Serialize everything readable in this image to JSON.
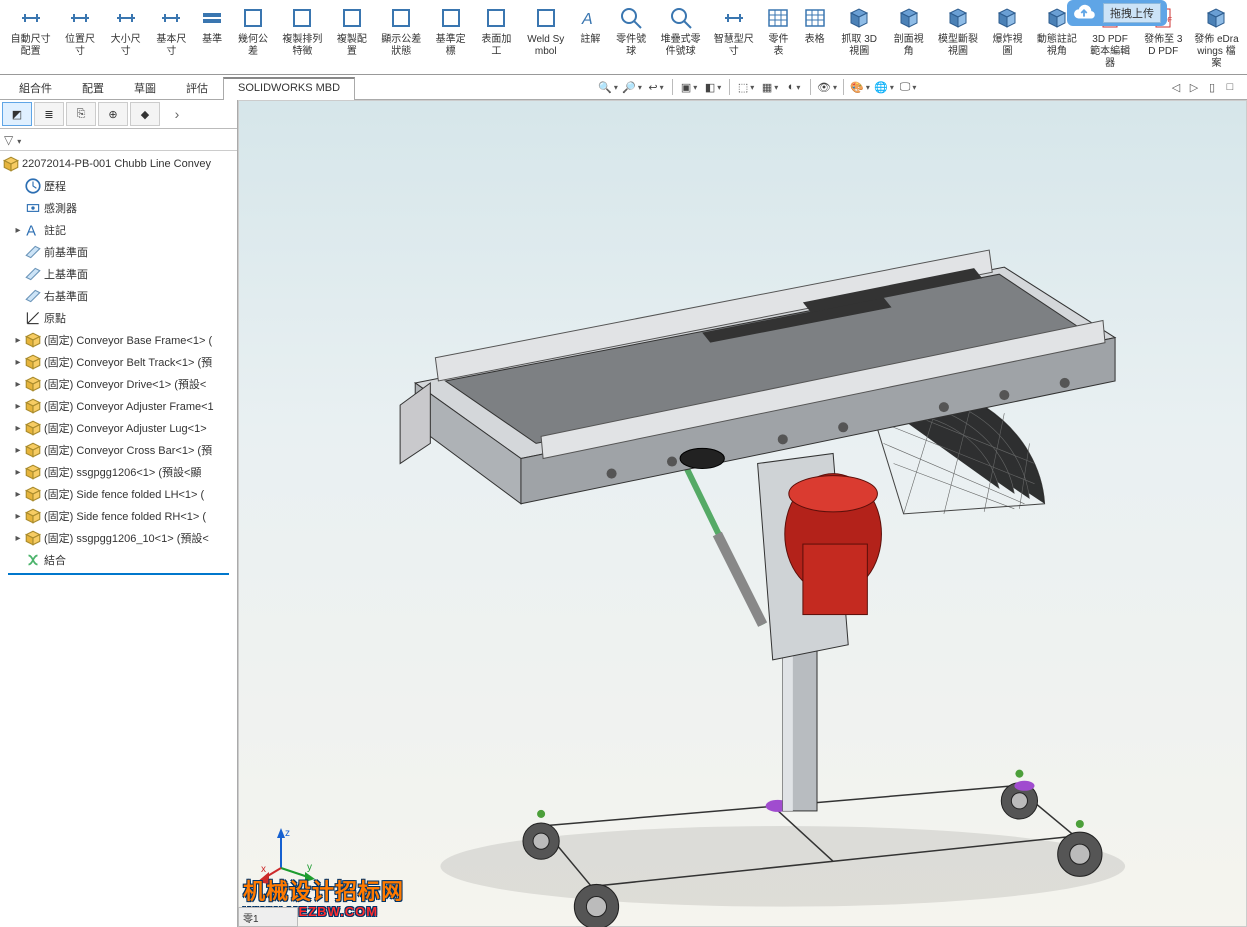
{
  "upload": {
    "label": "拖拽上传"
  },
  "ribbon": [
    {
      "name": "auto-dimension",
      "label": "自動尺寸配置"
    },
    {
      "name": "location-dimension",
      "label": "位置尺寸"
    },
    {
      "name": "size-dimension",
      "label": "大小尺寸"
    },
    {
      "name": "basic-dimension",
      "label": "基本尺寸"
    },
    {
      "name": "datum",
      "label": "基準"
    },
    {
      "name": "geometric-tolerance",
      "label": "幾何公差"
    },
    {
      "name": "pattern-feature",
      "label": "複製排列特徵"
    },
    {
      "name": "copy-scheme",
      "label": "複製配置"
    },
    {
      "name": "show-tolerance-status",
      "label": "顯示公差狀態"
    },
    {
      "name": "datum-target",
      "label": "基準定標"
    },
    {
      "name": "surface-finish",
      "label": "表面加工"
    },
    {
      "name": "weld-symbol",
      "label": "Weld Symbol"
    },
    {
      "name": "note",
      "label": "註解"
    },
    {
      "name": "balloon",
      "label": "零件號球"
    },
    {
      "name": "stacked-balloon",
      "label": "堆疊式零件號球"
    },
    {
      "name": "smart-dimension",
      "label": "智慧型尺寸"
    },
    {
      "name": "tables",
      "label": "零件表"
    },
    {
      "name": "tables2",
      "label": "表格"
    },
    {
      "name": "capture-3d-view",
      "label": "抓取 3D 視圖"
    },
    {
      "name": "section-view",
      "label": "剖面視角"
    },
    {
      "name": "model-break-view",
      "label": "模型斷裂視圖"
    },
    {
      "name": "exploded-view",
      "label": "爆炸視圖"
    },
    {
      "name": "dynamic-annotation",
      "label": "動態註記視角"
    },
    {
      "name": "3dpdf-template",
      "label": "3D PDF 範本編輯器"
    },
    {
      "name": "publish-3dpdf",
      "label": "發佈至 3D PDF"
    },
    {
      "name": "publish-edrawings",
      "label": "發佈 eDrawings 檔案"
    }
  ],
  "tabs": {
    "items": [
      "組合件",
      "配置",
      "草圖",
      "評估",
      "SOLIDWORKS MBD"
    ],
    "activeIndex": 4
  },
  "view_toolbar_icons": [
    "zoom-fit",
    "zoom-area",
    "prev-view",
    "section",
    "display-style",
    "cube",
    "scene",
    "shadow",
    "visibility",
    "appearance",
    "render",
    "monitor"
  ],
  "pane_right_icons": [
    "prev",
    "next",
    "split",
    "max"
  ],
  "sidebar": {
    "tabs": [
      "feature-tree",
      "property",
      "config",
      "display",
      "appearance"
    ],
    "root": "22072014-PB-001 Chubb Line Convey",
    "items": [
      {
        "icon": "history",
        "label": "歷程"
      },
      {
        "icon": "sensor",
        "label": "感測器"
      },
      {
        "icon": "annotation",
        "label": "註記",
        "expandable": true
      },
      {
        "icon": "plane",
        "label": "前基準面"
      },
      {
        "icon": "plane",
        "label": "上基準面"
      },
      {
        "icon": "plane",
        "label": "右基準面"
      },
      {
        "icon": "origin",
        "label": "原點"
      },
      {
        "icon": "part",
        "label": "(固定) Conveyor Base Frame<1> (",
        "expandable": true
      },
      {
        "icon": "part",
        "label": "(固定) Conveyor Belt Track<1> (預",
        "expandable": true
      },
      {
        "icon": "part",
        "label": "(固定) Conveyor Drive<1> (預設<",
        "expandable": true
      },
      {
        "icon": "part",
        "label": "(固定) Conveyor Adjuster Frame<1",
        "expandable": true
      },
      {
        "icon": "part",
        "label": "(固定) Conveyor Adjuster Lug<1>",
        "expandable": true
      },
      {
        "icon": "part",
        "label": "(固定) Conveyor Cross Bar<1> (預",
        "expandable": true
      },
      {
        "icon": "part",
        "label": "(固定) ssgpgg1206<1> (預設<顯",
        "expandable": true
      },
      {
        "icon": "part",
        "label": "(固定) Side fence folded LH<1> (",
        "expandable": true
      },
      {
        "icon": "part",
        "label": "(固定) Side fence folded RH<1> (",
        "expandable": true
      },
      {
        "icon": "part",
        "label": "(固定) ssgpgg1206_10<1> (預設<",
        "expandable": true
      },
      {
        "icon": "mates",
        "label": "結合"
      }
    ]
  },
  "triad": {
    "x": "x",
    "y": "y",
    "z": "z"
  },
  "watermark": {
    "line1": "机械设计招标网",
    "line2": "WWW.MEZBW.COM"
  },
  "status_stub": "零1"
}
